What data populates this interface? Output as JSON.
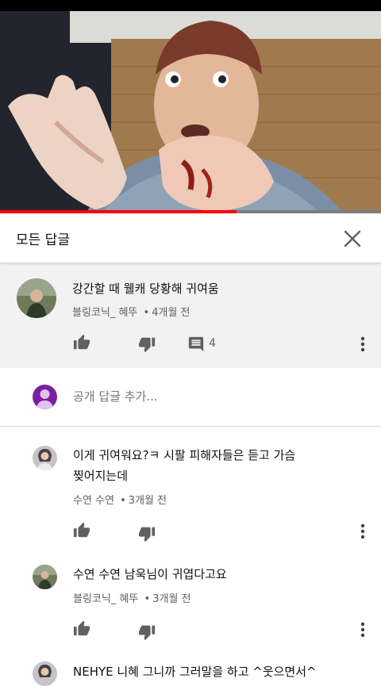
{
  "header": {
    "title": "모든 답글"
  },
  "video": {
    "progress": 0.62
  },
  "parent_comment": {
    "text": "강간할 때 웰캐 당황해 귀여움",
    "author": "블링코닉_ 혜뚜",
    "time": "4개월 전",
    "reply_count": "4"
  },
  "add_reply": {
    "placeholder": "공개 답글 추가..."
  },
  "replies": [
    {
      "line1": "이게 귀여워요?ㅋ 시팔 피해자들은 듣고 가슴",
      "line2": "찢어지는데",
      "author": "수연 수연",
      "time": "3개월 전"
    },
    {
      "line1": "수연 수연 남욱님이 귀엽다고요",
      "author": "블링코닉_ 혜뚜",
      "time": "3개월 전"
    },
    {
      "line1": "NEHYE 니혜 그니까 그러말을 하고 ^웃으면서^"
    }
  ],
  "meta_separator": "•",
  "colors": {
    "progress": "#ff0000",
    "avatar_purple": "#7b1fa2",
    "parent_bg": "#f2f2f2"
  }
}
